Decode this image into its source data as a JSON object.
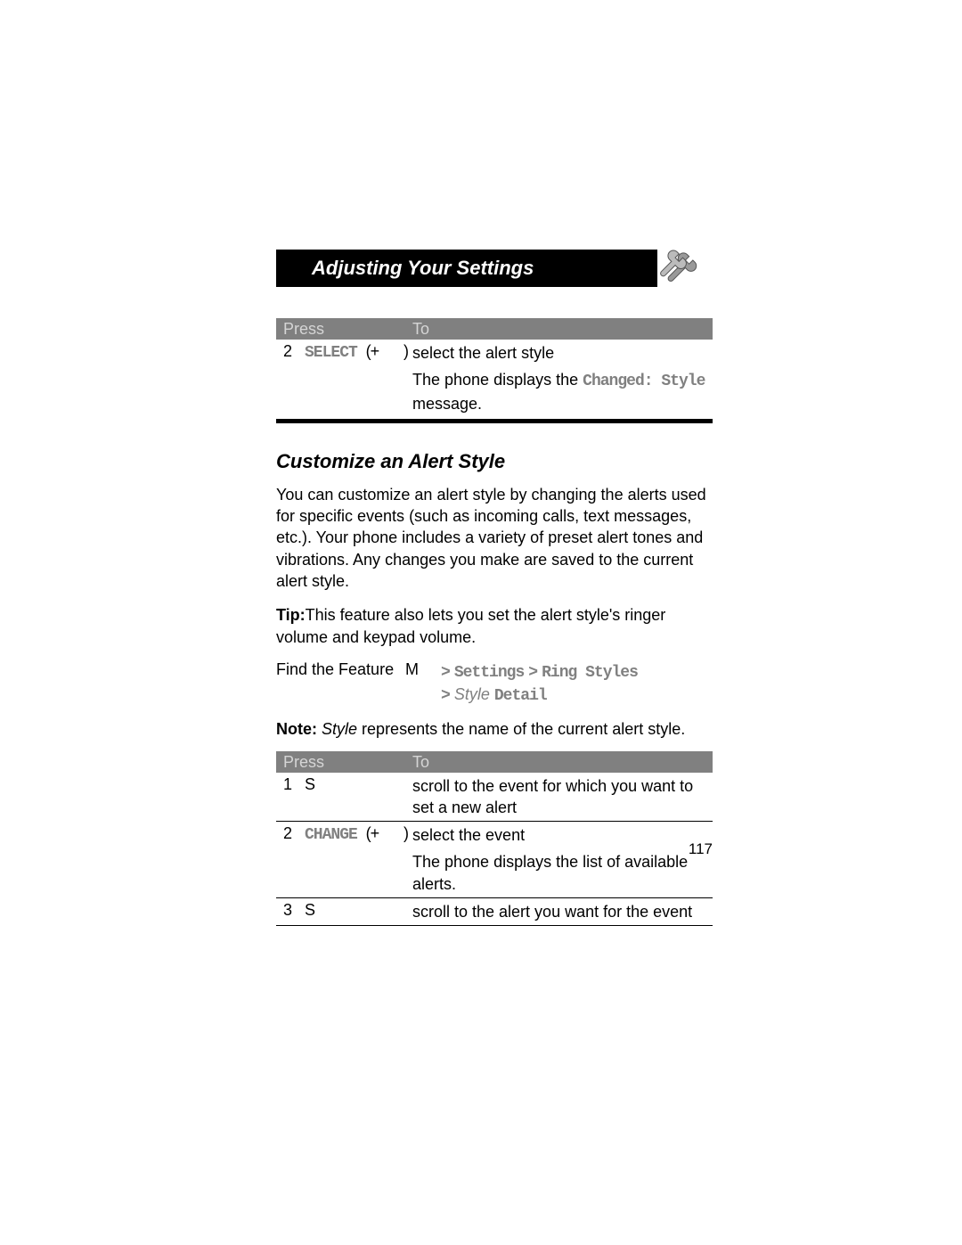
{
  "header": {
    "title": "Adjusting Your Settings"
  },
  "table1": {
    "header_press": "Press",
    "header_to": "To",
    "row": {
      "num": "2",
      "key_part1": "SELECT",
      "key_part2": "(+",
      "key_part3": ")",
      "desc_line1": "select the alert style",
      "desc_line2a": "The phone displays the ",
      "desc_line2b": "Changed: Style",
      "desc_line2c": " message."
    }
  },
  "section": {
    "title": "Customize an Alert Style",
    "para1": "You can customize an alert style by changing the alerts used for specific events (such as incoming calls, text messages, etc.). Your phone includes a variety of preset alert tones and vibrations. Any changes you make are saved to the current alert style.",
    "tip_label": "Tip:",
    "tip_text": "This feature also lets you set the alert style's ringer volume and keypad volume.",
    "feature_label": "Find the Feature",
    "feature_m": "M",
    "path1_prefix": ">",
    "path1_a": "Settings",
    "path1_sep": ">",
    "path1_b": "Ring Styles",
    "path2_prefix": ">",
    "path2_style": "Style",
    "path2_detail": "Detail",
    "note_label": "Note:",
    "note_style": "Style",
    "note_text": " represents the name of the current alert style."
  },
  "table2": {
    "header_press": "Press",
    "header_to": "To",
    "rows": [
      {
        "num": "1",
        "key": "S",
        "desc": "scroll to the event for which you want to set a new alert"
      },
      {
        "num": "2",
        "key_part1": "CHANGE",
        "key_part2": "(+",
        "key_part3": ")",
        "desc_line1": "select the event",
        "desc_line2": "The phone displays the list of available alerts."
      },
      {
        "num": "3",
        "key": "S",
        "desc": "scroll to the alert you want for the event"
      }
    ]
  },
  "page_number": "117"
}
